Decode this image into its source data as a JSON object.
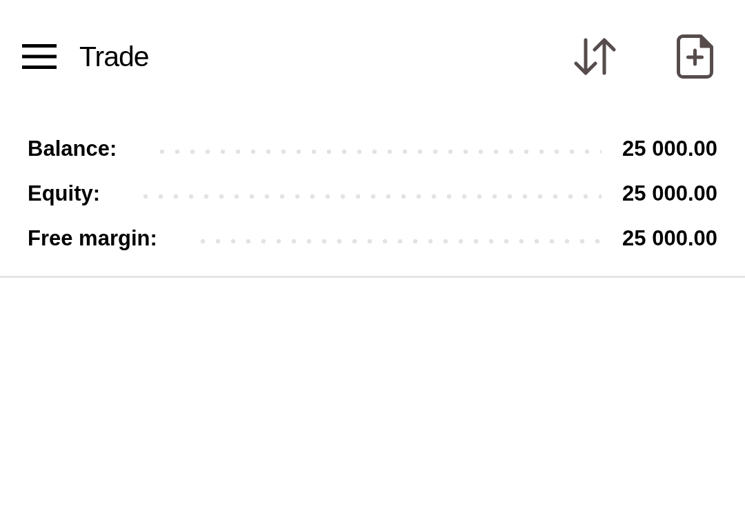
{
  "header": {
    "title": "Trade"
  },
  "account": [
    {
      "label": "Balance:",
      "value": "25 000.00"
    },
    {
      "label": "Equity:",
      "value": "25 000.00"
    },
    {
      "label": "Free margin:",
      "value": "25 000.00"
    }
  ]
}
